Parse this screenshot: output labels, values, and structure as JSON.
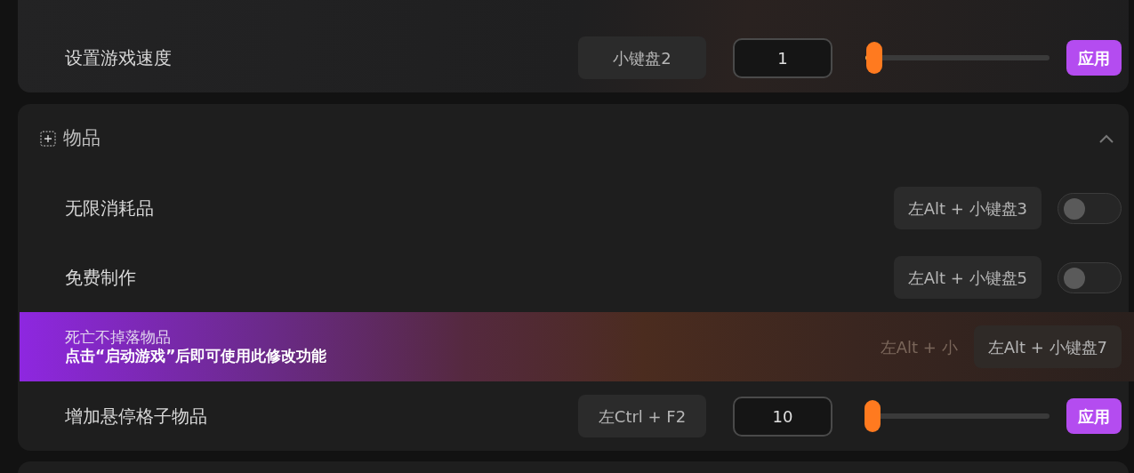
{
  "top_card": {
    "rows": [
      {
        "kind": "slider",
        "label": "设置游戏速度",
        "hotkey": "小键盘2",
        "value": "1",
        "level": 0.05,
        "apply": "应用"
      }
    ]
  },
  "items_section": {
    "title": "物品",
    "expanded": true,
    "rows": [
      {
        "kind": "toggle",
        "label": "无限消耗品",
        "hotkey": "左Alt + 小键盘3",
        "on": false
      },
      {
        "kind": "toggle",
        "label": "免费制作",
        "hotkey": "左Alt + 小键盘5",
        "on": false
      },
      {
        "kind": "banner",
        "label": "死亡不掉落物品",
        "notice": "点击“启动游戏”后即可使用此修改功能",
        "hotkey_faded": "左Alt + 小",
        "hotkey": "左Alt + 小键盘7"
      },
      {
        "kind": "slider",
        "label": "增加悬停格子物品",
        "hotkey": "左Ctrl + F2",
        "value": "10",
        "level": 0.04,
        "apply": "应用"
      }
    ]
  }
}
